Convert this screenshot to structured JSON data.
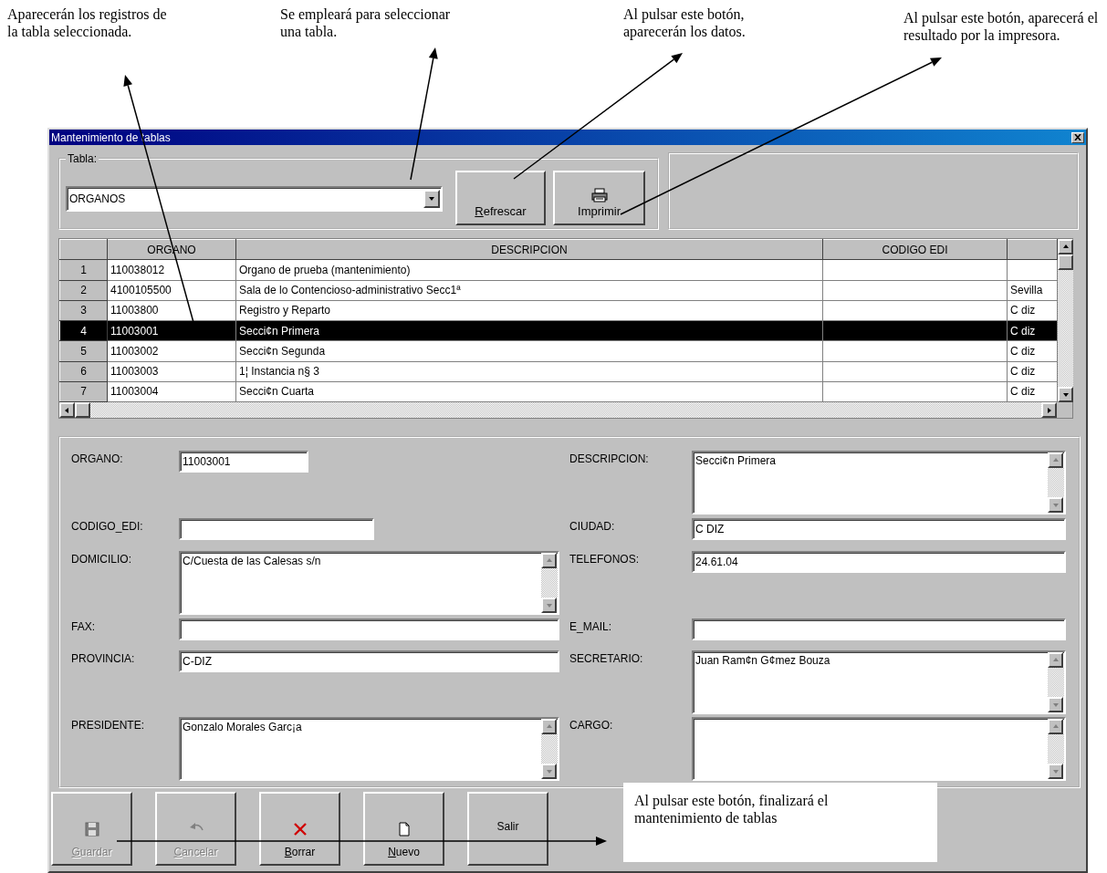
{
  "annotations": [
    {
      "text": "Aparecerán los registros de la tabla seleccionada."
    },
    {
      "text": "Se empleará para seleccionar una tabla."
    },
    {
      "text": "Al pulsar este botón, aparecerán los datos."
    },
    {
      "text": "Al pulsar este botón, aparecerá el resultado por la impresora."
    },
    {
      "text": "Al pulsar este botón, finalizará el mantenimiento de tablas"
    }
  ],
  "window": {
    "title": "Mantenimiento de tablas"
  },
  "table_group": {
    "label": "Tabla:",
    "value": "ORGANOS"
  },
  "toolbar": [
    {
      "label": "Refrescar",
      "kind": "refresh",
      "underline_first": true
    },
    {
      "label": "Imprimir",
      "kind": "print",
      "underline_first": false
    }
  ],
  "grid": {
    "columns": [
      {
        "label": "ORGANO"
      },
      {
        "label": "DESCRIPCION"
      },
      {
        "label": "CODIGO EDI"
      }
    ],
    "rows": [
      {
        "number": "1",
        "organo": "110038012",
        "descripcion": "Organo de prueba (mantenimiento)",
        "selected": false
      },
      {
        "number": "2",
        "organo": "4100105500",
        "descripcion": "Sala de lo Contencioso-administrativo Secc1ª",
        "column_5": "Sevilla",
        "selected": false
      },
      {
        "number": "3",
        "organo": "11003800",
        "descripcion": "Registro y Reparto",
        "column_5": "C diz",
        "selected": false
      },
      {
        "number": "4",
        "organo": "11003001",
        "descripcion": "Secci¢n Primera",
        "column_5": "C diz",
        "selected": true
      },
      {
        "number": "5",
        "organo": "11003002",
        "descripcion": "Secci¢n Segunda",
        "column_5": "C diz",
        "selected": false
      },
      {
        "number": "6",
        "organo": "11003003",
        "descripcion": "1¦ Instancia n§ 3",
        "column_5": "C diz",
        "selected": false
      },
      {
        "number": "7",
        "organo": "11003004",
        "descripcion": "Secci¢n Cuarta",
        "column_5": "C diz",
        "selected": false
      }
    ]
  },
  "form": {
    "rows": [
      {
        "left": {
          "label": "ORGANO:",
          "kind": "short",
          "value": "11003001"
        },
        "right": {
          "label": "DESCRIPCION:",
          "kind": "memo",
          "value": "Secci¢n Primera"
        }
      },
      {
        "left": {
          "label": "CODIGO_EDI:",
          "kind": "medium"
        },
        "right": {
          "label": "CIUDAD:",
          "kind": "long",
          "value": "C DIZ"
        }
      },
      {
        "left": {
          "label": "DOMICILIO:",
          "kind": "memo",
          "value": "C/Cuesta de las Calesas s/n"
        },
        "right": {
          "label": "TELEFONOS:",
          "kind": "long",
          "value": "24.61.04"
        }
      },
      {
        "left": {
          "label": "FAX:",
          "kind": "long"
        },
        "right": {
          "label": "E_MAIL:",
          "kind": "long"
        }
      },
      {
        "left": {
          "label": "PROVINCIA:",
          "kind": "long",
          "value": "C-DIZ"
        },
        "right": {
          "label": "SECRETARIO:",
          "kind": "memo",
          "value": "Juan Ram¢n G¢mez Bouza"
        }
      },
      {
        "left": {
          "label": "PRESIDENTE:",
          "kind": "memo",
          "value": "Gonzalo Morales Garc¡a"
        },
        "right": {
          "label": "CARGO:",
          "kind": "memo"
        }
      }
    ]
  },
  "buttons": [
    {
      "label": "Guardar",
      "kind": "save",
      "disabled": true,
      "underline_first": true
    },
    {
      "label": "Cancelar",
      "kind": "undo",
      "disabled": true,
      "underline_first": true
    },
    {
      "label": "Borrar",
      "kind": "delete",
      "disabled": false,
      "underline_first": true
    },
    {
      "label": "Nuevo",
      "kind": "new",
      "disabled": false,
      "underline_first": true
    },
    {
      "label": "Salir",
      "kind": "exit",
      "disabled": false,
      "underline_first": false
    }
  ]
}
